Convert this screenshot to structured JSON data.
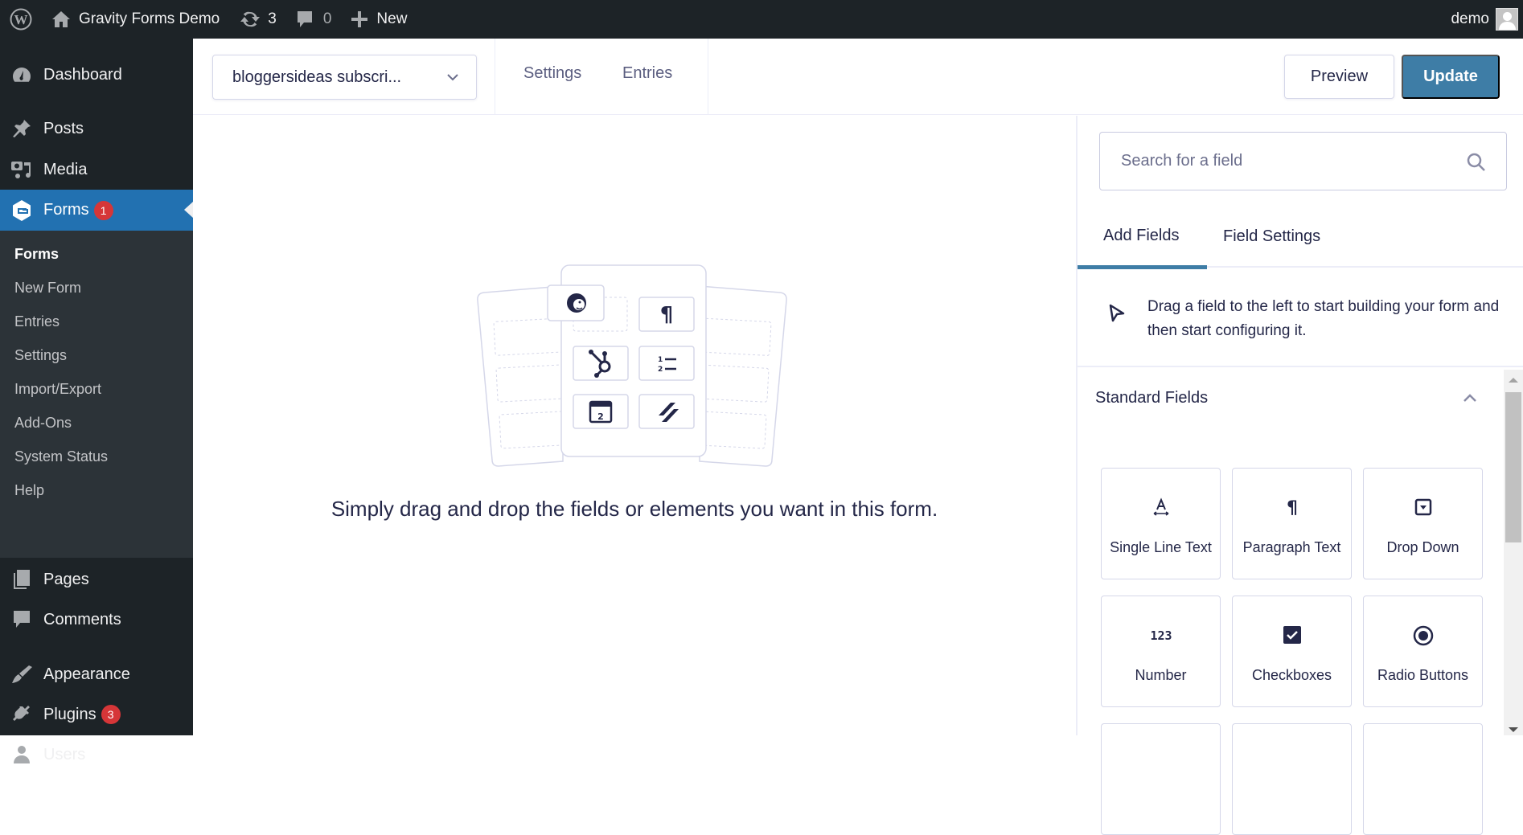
{
  "adminbar": {
    "site_name": "Gravity Forms Demo",
    "updates_count": "3",
    "comments_count": "0",
    "new_label": "New",
    "user_name": "demo"
  },
  "sidebar": {
    "items": [
      {
        "label": "Dashboard",
        "icon": "dashboard-icon"
      },
      {
        "label": "Posts",
        "icon": "pin-icon"
      },
      {
        "label": "Media",
        "icon": "media-icon"
      },
      {
        "label": "Forms",
        "icon": "gravity-forms-icon",
        "badge": "1",
        "active": true
      },
      {
        "label": "Pages",
        "icon": "pages-icon"
      },
      {
        "label": "Comments",
        "icon": "comment-icon"
      },
      {
        "label": "Appearance",
        "icon": "paintbrush-icon"
      },
      {
        "label": "Plugins",
        "icon": "plugin-icon",
        "badge": "3"
      },
      {
        "label": "Users",
        "icon": "user-icon"
      }
    ],
    "submenu": [
      {
        "label": "Forms",
        "current": true
      },
      {
        "label": "New Form"
      },
      {
        "label": "Entries"
      },
      {
        "label": "Settings"
      },
      {
        "label": "Import/Export"
      },
      {
        "label": "Add-Ons"
      },
      {
        "label": "System Status"
      },
      {
        "label": "Help"
      }
    ]
  },
  "header": {
    "form_select_value": "bloggersideas subscri...",
    "links": [
      "Settings",
      "Entries"
    ],
    "preview_label": "Preview",
    "update_label": "Update"
  },
  "canvas": {
    "empty_message": "Simply drag and drop the fields or elements you want in this form."
  },
  "panel": {
    "search_placeholder": "Search for a field",
    "tabs": [
      {
        "label": "Add Fields",
        "active": true
      },
      {
        "label": "Field Settings"
      }
    ],
    "info_text": "Drag a field to the left to start building your form and then start configuring it.",
    "section_title": "Standard Fields",
    "fields": [
      {
        "label": "Single Line Text",
        "icon": "text-input-icon"
      },
      {
        "label": "Paragraph Text",
        "icon": "paragraph-icon"
      },
      {
        "label": "Drop Down",
        "icon": "dropdown-icon"
      },
      {
        "label": "Number",
        "icon": "number-icon"
      },
      {
        "label": "Checkboxes",
        "icon": "checkbox-icon"
      },
      {
        "label": "Radio Buttons",
        "icon": "radio-icon"
      }
    ]
  },
  "colors": {
    "adminbar_bg": "#1d2327",
    "menu_active": "#2271b1",
    "submenu_bg": "#2c3338",
    "accent": "#3e7da6",
    "badge": "#d63638",
    "text_dark": "#242748"
  }
}
